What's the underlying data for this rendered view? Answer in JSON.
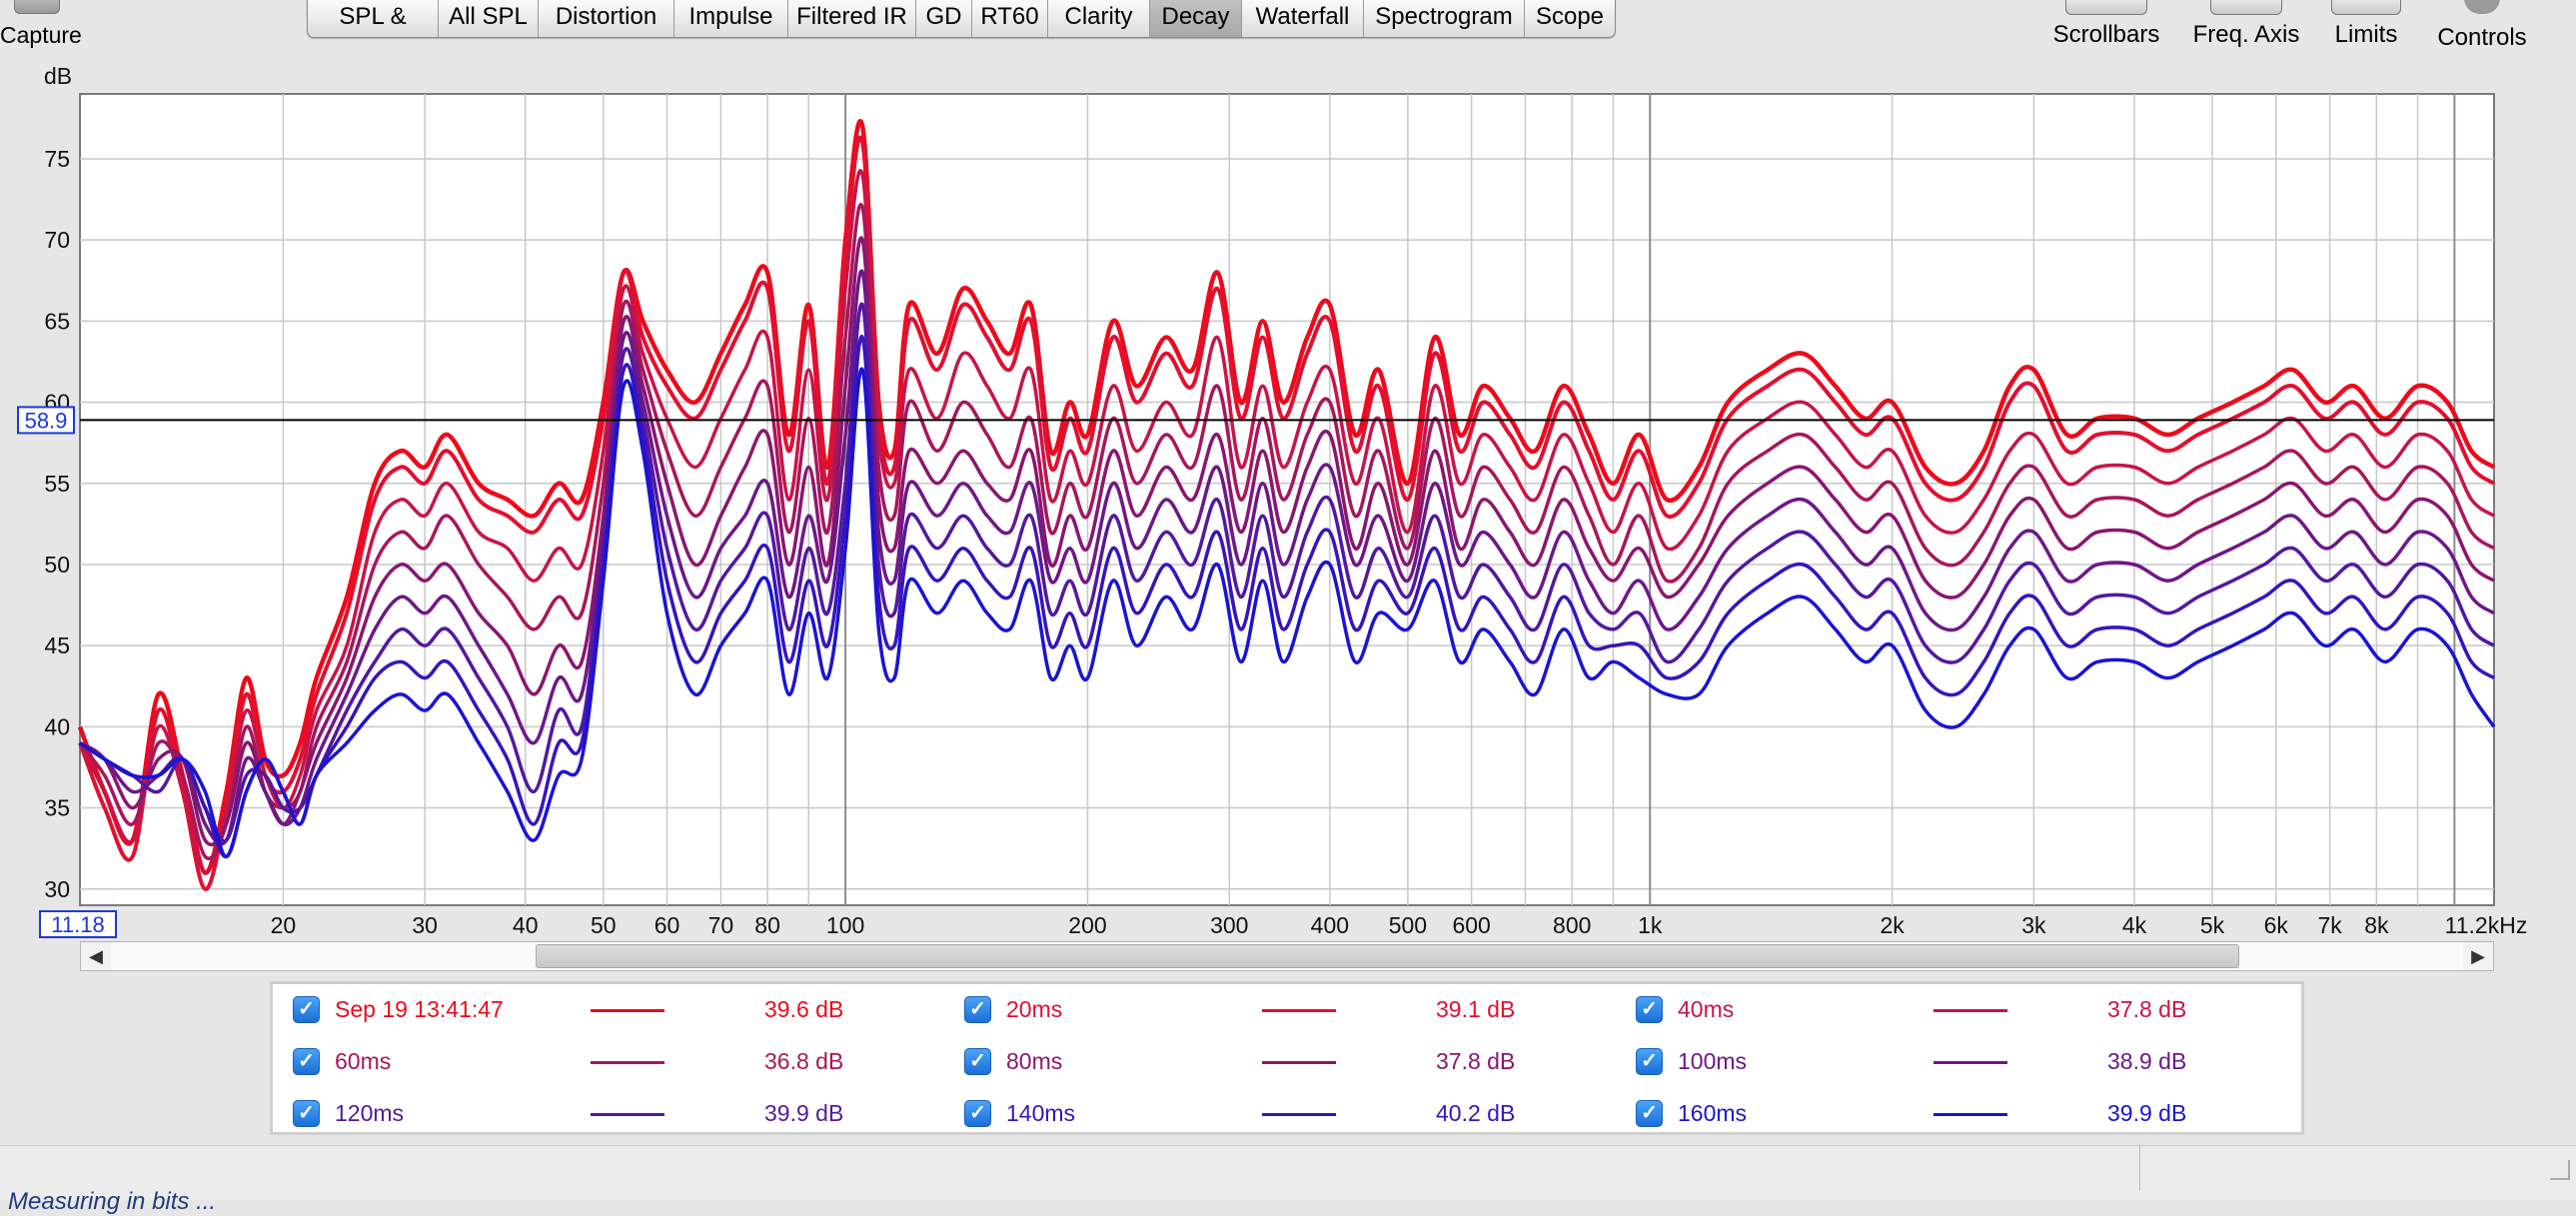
{
  "capture": {
    "label": "Capture"
  },
  "tabs": [
    {
      "label": "SPL & Phase"
    },
    {
      "label": "All SPL"
    },
    {
      "label": "Distortion"
    },
    {
      "label": "Impulse"
    },
    {
      "label": "Filtered IR"
    },
    {
      "label": "GD"
    },
    {
      "label": "RT60"
    },
    {
      "label": "Clarity"
    },
    {
      "label": "Decay",
      "active": true
    },
    {
      "label": "Waterfall"
    },
    {
      "label": "Spectrogram"
    },
    {
      "label": "Scope"
    }
  ],
  "tools": {
    "scrollbars": "Scrollbars",
    "freq_axis": "Freq. Axis",
    "limits": "Limits",
    "controls": "Controls"
  },
  "chart_data": {
    "type": "line",
    "ylabel": "dB",
    "xunit": "kHz",
    "xscale": "log",
    "xlim": [
      11.18,
      11200
    ],
    "ylim": [
      29,
      79
    ],
    "yticks": [
      30,
      35,
      40,
      45,
      50,
      55,
      60,
      65,
      70,
      75
    ],
    "xticks": [
      {
        "v": 20,
        "label": "20"
      },
      {
        "v": 30,
        "label": "30"
      },
      {
        "v": 40,
        "label": "40"
      },
      {
        "v": 50,
        "label": "50"
      },
      {
        "v": 60,
        "label": "60"
      },
      {
        "v": 70,
        "label": "70"
      },
      {
        "v": 80,
        "label": "80"
      },
      {
        "v": 100,
        "label": "100"
      },
      {
        "v": 200,
        "label": "200"
      },
      {
        "v": 300,
        "label": "300"
      },
      {
        "v": 400,
        "label": "400"
      },
      {
        "v": 500,
        "label": "500"
      },
      {
        "v": 600,
        "label": "600"
      },
      {
        "v": 800,
        "label": "800"
      },
      {
        "v": 1000,
        "label": "1k"
      },
      {
        "v": 2000,
        "label": "2k"
      },
      {
        "v": 3000,
        "label": "3k"
      },
      {
        "v": 4000,
        "label": "4k"
      },
      {
        "v": 5000,
        "label": "5k"
      },
      {
        "v": 6000,
        "label": "6k"
      },
      {
        "v": 7000,
        "label": "7k"
      },
      {
        "v": 8000,
        "label": "8k"
      }
    ],
    "xmin_label": "11.18",
    "xmax_label": "11.2kHz",
    "cursor_y": 58.9,
    "cursor_label": "58.9",
    "grid": true,
    "x": [
      11.18,
      12,
      13,
      14,
      15,
      16,
      17,
      18,
      19,
      20,
      21,
      22,
      24,
      26,
      28,
      30,
      32,
      35,
      38,
      41,
      44,
      47,
      50,
      53,
      56,
      60,
      65,
      70,
      75,
      80,
      85,
      90,
      95,
      100,
      105,
      110,
      115,
      120,
      130,
      140,
      150,
      160,
      170,
      180,
      190,
      200,
      215,
      230,
      250,
      270,
      290,
      310,
      330,
      350,
      375,
      400,
      430,
      460,
      500,
      540,
      580,
      620,
      670,
      720,
      780,
      840,
      900,
      970,
      1050,
      1150,
      1250,
      1400,
      1550,
      1700,
      1850,
      2000,
      2200,
      2400,
      2600,
      2800,
      3000,
      3300,
      3600,
      4000,
      4400,
      4800,
      5300,
      5800,
      6300,
      6900,
      7500,
      8200,
      9000,
      9800,
      10500,
      11200
    ],
    "series": [
      {
        "name": "Sep 19 13:41:47",
        "color": "#ee0a1a",
        "width": 4.5,
        "values": [
          40,
          36,
          33,
          42,
          37,
          31,
          36,
          43,
          38,
          37,
          39,
          43,
          48,
          55,
          57,
          56,
          58,
          55,
          54,
          53,
          55,
          54,
          60,
          68,
          65,
          62,
          60,
          63,
          66,
          68,
          58,
          66,
          56,
          70,
          77,
          60,
          57,
          66,
          63,
          67,
          65,
          63,
          66,
          57,
          60,
          58,
          65,
          61,
          64,
          62,
          68,
          60,
          65,
          60,
          64,
          66,
          58,
          62,
          55,
          64,
          58,
          61,
          59,
          57,
          61,
          58,
          55,
          58,
          54,
          56,
          60,
          62,
          63,
          61,
          59,
          60,
          56,
          55,
          57,
          61,
          62,
          58,
          59,
          59,
          58,
          59,
          60,
          61,
          62,
          60,
          61,
          59,
          61,
          60,
          57,
          56
        ]
      },
      {
        "name": "20ms",
        "color": "#e21030",
        "width": 4,
        "values": [
          39,
          35,
          32,
          41,
          36,
          30,
          35,
          42,
          37,
          36,
          38,
          42,
          47,
          54,
          56,
          55,
          57,
          54,
          53,
          52,
          54,
          53,
          59,
          68,
          64,
          61,
          59,
          62,
          65,
          67,
          57,
          65,
          55,
          69,
          76,
          59,
          56,
          65,
          62,
          66,
          64,
          62,
          65,
          56,
          59,
          57,
          64,
          60,
          63,
          61,
          67,
          59,
          64,
          59,
          63,
          65,
          57,
          61,
          54,
          63,
          57,
          60,
          58,
          56,
          60,
          57,
          54,
          57,
          53,
          55,
          59,
          61,
          62,
          60,
          58,
          59,
          55,
          54,
          56,
          60,
          61,
          57,
          58,
          58,
          57,
          58,
          59,
          60,
          61,
          59,
          60,
          58,
          60,
          59,
          56,
          55
        ]
      },
      {
        "name": "40ms",
        "color": "#c81448",
        "width": 3.5,
        "values": [
          39,
          36,
          33,
          40,
          36,
          31,
          35,
          41,
          37,
          35,
          37,
          41,
          45,
          52,
          54,
          53,
          55,
          52,
          51,
          49,
          51,
          50,
          57,
          67,
          63,
          59,
          56,
          59,
          62,
          64,
          54,
          62,
          54,
          67,
          74,
          58,
          55,
          62,
          59,
          63,
          61,
          59,
          62,
          54,
          57,
          55,
          61,
          57,
          60,
          58,
          64,
          56,
          61,
          56,
          60,
          62,
          55,
          59,
          52,
          61,
          55,
          58,
          56,
          54,
          58,
          55,
          52,
          55,
          51,
          53,
          57,
          59,
          60,
          58,
          56,
          57,
          53,
          52,
          54,
          57,
          58,
          55,
          56,
          56,
          55,
          56,
          57,
          58,
          59,
          57,
          58,
          56,
          58,
          57,
          54,
          53
        ]
      },
      {
        "name": "60ms",
        "color": "#a8165c",
        "width": 3.5,
        "values": [
          39,
          37,
          34,
          39,
          37,
          32,
          34,
          40,
          36,
          35,
          36,
          40,
          44,
          50,
          52,
          51,
          53,
          50,
          48,
          46,
          48,
          47,
          55,
          66,
          62,
          57,
          53,
          56,
          59,
          61,
          52,
          59,
          52,
          64,
          72,
          56,
          53,
          60,
          57,
          60,
          58,
          56,
          59,
          52,
          55,
          53,
          59,
          55,
          58,
          56,
          61,
          54,
          59,
          54,
          58,
          60,
          53,
          57,
          51,
          59,
          53,
          56,
          54,
          52,
          56,
          53,
          50,
          53,
          49,
          51,
          55,
          57,
          58,
          56,
          54,
          55,
          51,
          50,
          52,
          55,
          56,
          53,
          54,
          54,
          53,
          54,
          55,
          56,
          57,
          55,
          56,
          54,
          56,
          55,
          52,
          51
        ]
      },
      {
        "name": "80ms",
        "color": "#8a1670",
        "width": 3.5,
        "values": [
          39,
          38,
          35,
          38,
          38,
          33,
          34,
          39,
          36,
          34,
          36,
          39,
          43,
          48,
          50,
          49,
          50,
          47,
          45,
          42,
          45,
          44,
          53,
          65,
          61,
          55,
          50,
          53,
          56,
          58,
          50,
          56,
          50,
          61,
          70,
          54,
          51,
          57,
          55,
          57,
          55,
          54,
          57,
          50,
          53,
          51,
          57,
          53,
          56,
          54,
          58,
          52,
          57,
          52,
          56,
          58,
          51,
          55,
          50,
          57,
          51,
          54,
          52,
          50,
          54,
          51,
          49,
          51,
          48,
          50,
          53,
          55,
          56,
          54,
          52,
          53,
          49,
          48,
          50,
          53,
          54,
          51,
          52,
          52,
          51,
          52,
          53,
          54,
          55,
          53,
          54,
          52,
          54,
          53,
          50,
          49
        ]
      },
      {
        "name": "100ms",
        "color": "#6e1888",
        "width": 3.5,
        "values": [
          39,
          38,
          36,
          37,
          38,
          34,
          33,
          38,
          36,
          34,
          35,
          38,
          42,
          46,
          48,
          47,
          48,
          45,
          42,
          39,
          43,
          42,
          52,
          64,
          60,
          53,
          48,
          51,
          53,
          55,
          48,
          53,
          49,
          58,
          68,
          52,
          49,
          55,
          53,
          55,
          53,
          52,
          55,
          49,
          51,
          49,
          55,
          51,
          54,
          52,
          56,
          50,
          55,
          50,
          54,
          56,
          50,
          53,
          49,
          55,
          50,
          52,
          50,
          48,
          52,
          49,
          47,
          49,
          46,
          48,
          51,
          53,
          54,
          52,
          50,
          51,
          47,
          46,
          48,
          51,
          52,
          49,
          50,
          50,
          49,
          50,
          51,
          52,
          53,
          51,
          52,
          50,
          52,
          51,
          48,
          47
        ]
      },
      {
        "name": "120ms",
        "color": "#5418a0",
        "width": 3.5,
        "values": [
          39,
          38,
          37,
          36,
          38,
          35,
          33,
          37,
          37,
          35,
          35,
          37,
          41,
          44,
          46,
          45,
          46,
          43,
          40,
          36,
          41,
          40,
          51,
          63,
          59,
          51,
          46,
          49,
          51,
          53,
          46,
          51,
          47,
          55,
          66,
          50,
          47,
          53,
          51,
          53,
          51,
          50,
          53,
          47,
          49,
          47,
          53,
          49,
          52,
          50,
          54,
          48,
          53,
          48,
          52,
          54,
          48,
          51,
          48,
          53,
          48,
          50,
          48,
          46,
          50,
          47,
          46,
          47,
          44,
          46,
          49,
          51,
          52,
          50,
          48,
          49,
          45,
          44,
          46,
          49,
          50,
          47,
          48,
          48,
          47,
          48,
          49,
          50,
          51,
          49,
          50,
          48,
          50,
          49,
          46,
          45
        ]
      },
      {
        "name": "140ms",
        "color": "#3814bc",
        "width": 3.5,
        "values": [
          39,
          38,
          37,
          37,
          38,
          35,
          32,
          36,
          38,
          36,
          34,
          37,
          40,
          43,
          44,
          43,
          44,
          41,
          38,
          34,
          39,
          39,
          50,
          62,
          58,
          49,
          44,
          47,
          49,
          51,
          44,
          49,
          45,
          53,
          64,
          48,
          45,
          51,
          49,
          51,
          49,
          48,
          51,
          45,
          47,
          45,
          51,
          47,
          50,
          48,
          52,
          46,
          51,
          46,
          50,
          52,
          46,
          49,
          47,
          51,
          46,
          48,
          46,
          44,
          48,
          45,
          45,
          45,
          43,
          44,
          47,
          49,
          50,
          48,
          46,
          47,
          43,
          42,
          44,
          47,
          48,
          45,
          46,
          46,
          45,
          46,
          47,
          48,
          49,
          47,
          48,
          46,
          48,
          47,
          44,
          43
        ]
      },
      {
        "name": "160ms",
        "color": "#1a14d4",
        "width": 3.5,
        "values": [
          39,
          38,
          37,
          37,
          38,
          36,
          32,
          36,
          38,
          36,
          34,
          37,
          39,
          41,
          42,
          41,
          42,
          39,
          36,
          33,
          37,
          38,
          49,
          61,
          57,
          47,
          42,
          45,
          47,
          49,
          42,
          47,
          43,
          51,
          62,
          46,
          43,
          49,
          47,
          49,
          47,
          46,
          49,
          43,
          45,
          43,
          49,
          45,
          48,
          46,
          50,
          44,
          49,
          44,
          48,
          50,
          44,
          47,
          46,
          49,
          44,
          46,
          44,
          42,
          46,
          43,
          44,
          43,
          42,
          42,
          45,
          47,
          48,
          46,
          44,
          45,
          41,
          40,
          42,
          45,
          46,
          43,
          44,
          44,
          43,
          44,
          45,
          46,
          47,
          45,
          46,
          44,
          46,
          45,
          42,
          40
        ]
      }
    ]
  },
  "legend": [
    {
      "name": "Sep 19 13:41:47",
      "value": "39.6 dB",
      "color": "#ee0a1a"
    },
    {
      "name": "20ms",
      "value": "39.1 dB",
      "color": "#e21030"
    },
    {
      "name": "40ms",
      "value": "37.8 dB",
      "color": "#c81448"
    },
    {
      "name": "60ms",
      "value": "36.8 dB",
      "color": "#a8165c"
    },
    {
      "name": "80ms",
      "value": "37.8 dB",
      "color": "#8a1670"
    },
    {
      "name": "100ms",
      "value": "38.9 dB",
      "color": "#6e1888"
    },
    {
      "name": "120ms",
      "value": "39.9 dB",
      "color": "#5418a0"
    },
    {
      "name": "140ms",
      "value": "40.2 dB",
      "color": "#3814bc"
    },
    {
      "name": "160ms",
      "value": "39.9 dB",
      "color": "#1a14d4"
    }
  ],
  "checkbox_glyph": "✓",
  "scroll_arrows": {
    "left": "◀",
    "right": "▶"
  },
  "status": {
    "text": "Measuring in bits ..."
  }
}
